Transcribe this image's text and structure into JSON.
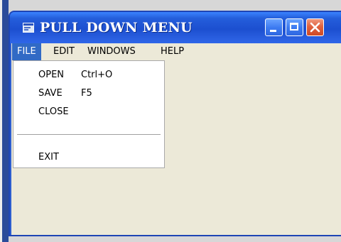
{
  "window": {
    "title": "PULL DOWN MENU",
    "icon": "app-icon"
  },
  "titlebar_buttons": {
    "minimize": "minimize-icon",
    "maximize": "maximize-icon",
    "close": "close-icon"
  },
  "menubar": {
    "items": [
      {
        "label": "FILE",
        "active": true
      },
      {
        "label": "EDIT",
        "active": false
      },
      {
        "label": "WINDOWS",
        "active": false
      },
      {
        "label": "HELP",
        "active": false
      }
    ]
  },
  "file_menu": {
    "items": [
      {
        "label": "OPEN",
        "shortcut": "Ctrl+O"
      },
      {
        "label": "SAVE",
        "shortcut": "F5"
      },
      {
        "label": "CLOSE",
        "shortcut": ""
      },
      {
        "label": "EXIT",
        "shortcut": ""
      }
    ]
  },
  "colors": {
    "titlebar": "#245edb",
    "menu_highlight": "#316ac5",
    "client_background": "#ece9d8",
    "close_button": "#e0623e"
  }
}
